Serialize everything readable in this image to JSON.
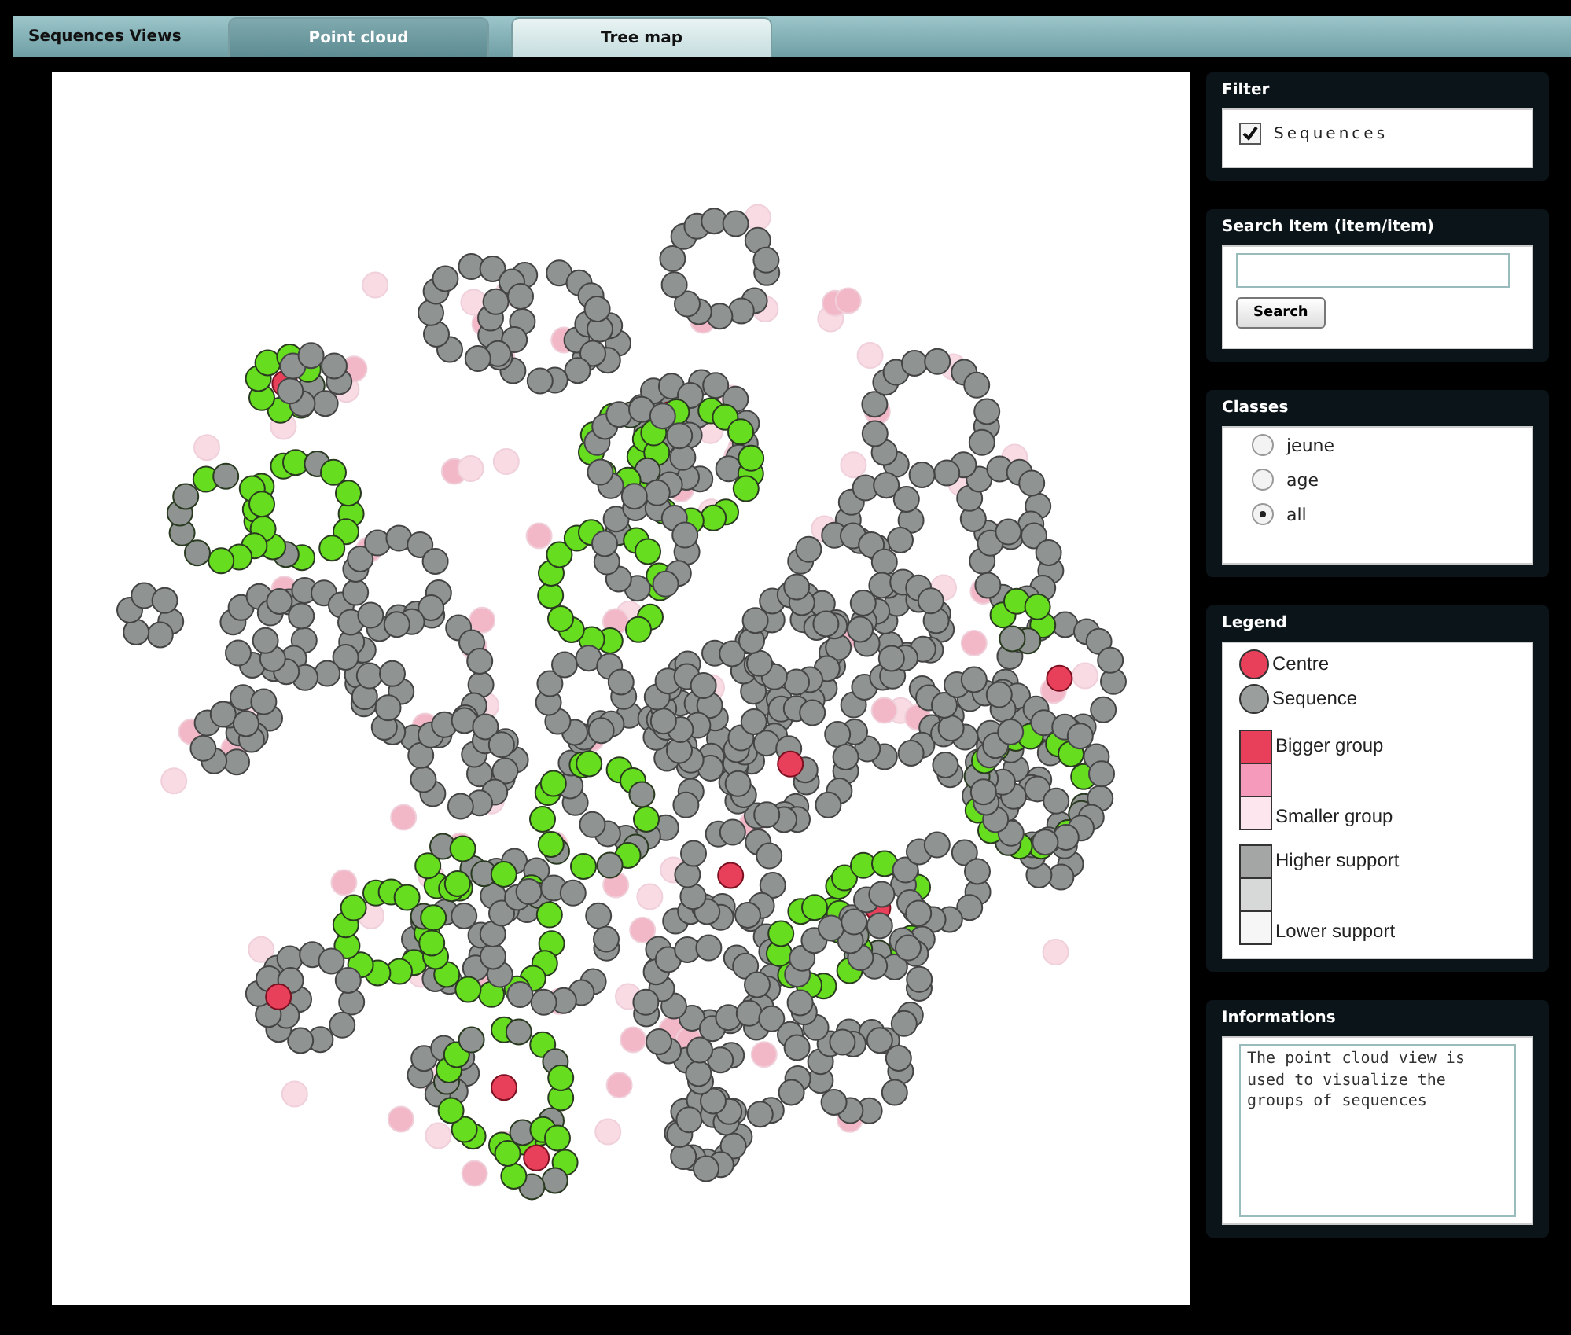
{
  "app_title": "Sequences Views",
  "tabs": [
    {
      "label": "Point cloud",
      "selected": true
    },
    {
      "label": "Tree map",
      "selected": false
    }
  ],
  "filter": {
    "title": "Filter",
    "items": [
      {
        "label": "Sequences",
        "checked": true
      }
    ]
  },
  "search": {
    "title": "Search Item (item/item)",
    "button": "Search"
  },
  "classes": {
    "title": "Classes",
    "options": [
      {
        "label": "jeune",
        "selected": false
      },
      {
        "label": "age",
        "selected": false
      },
      {
        "label": "all",
        "selected": true
      }
    ]
  },
  "legend": {
    "title": "Legend",
    "markers": [
      {
        "label": "Centre",
        "color": "#e8405a"
      },
      {
        "label": "Sequence",
        "color": "#9a9e9c"
      }
    ],
    "scales": [
      {
        "high_label": "Bigger group",
        "low_label": "Smaller group",
        "swatches": [
          {
            "color": "#e8405a"
          },
          {
            "color": "#f59abb"
          },
          {
            "color": "#fde6ee"
          }
        ]
      },
      {
        "high_label": "Higher support",
        "low_label": "Lower support",
        "swatches": [
          {
            "color": "#a3a6a4"
          },
          {
            "color": "#d6d9d7"
          },
          {
            "color": "#f6f6f6"
          }
        ]
      }
    ]
  },
  "informations": {
    "title": "Informations",
    "text": "The point cloud view is used to visualize the groups of sequences"
  }
}
